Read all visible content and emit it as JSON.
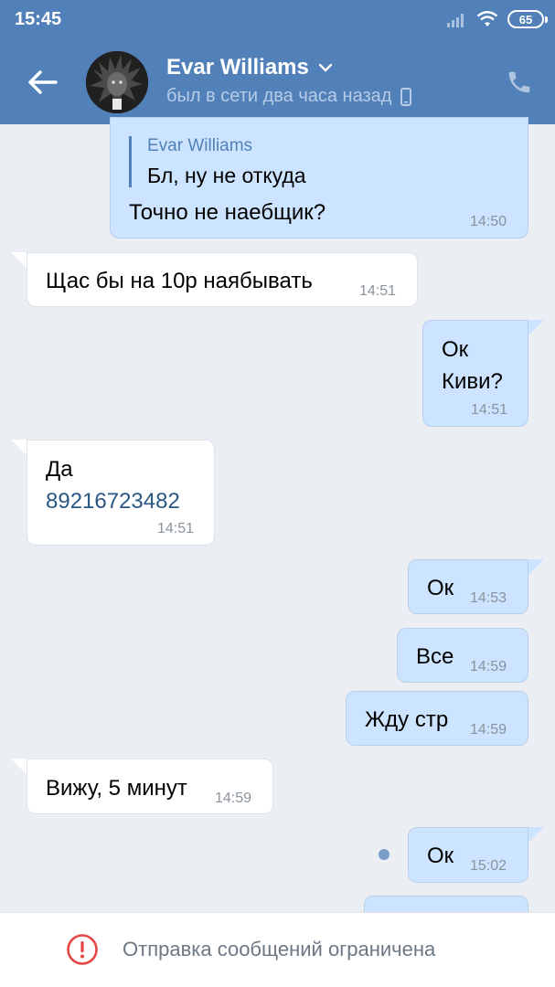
{
  "status_bar": {
    "time": "15:45",
    "battery": "65",
    "icons": [
      "signal-icon",
      "wifi-icon",
      "battery-icon"
    ]
  },
  "header": {
    "contact_name": "Evar Williams",
    "contact_status": "был в сети два часа назад",
    "icons": [
      "back-arrow-icon",
      "chevron-down-icon",
      "mobile-phone-icon",
      "phone-icon"
    ]
  },
  "messages": [
    {
      "direction": "out",
      "reply_to": {
        "author": "Evar Williams",
        "text": "Бл, ну не откуда"
      },
      "text": "Точно не наебщик?",
      "time": "14:50"
    },
    {
      "direction": "in",
      "text": "Щас бы на 10р наябывать",
      "time": "14:51"
    },
    {
      "direction": "out",
      "lines": [
        "Ок",
        "Киви?"
      ],
      "time": "14:51"
    },
    {
      "direction": "in",
      "text": "Да",
      "link": "89216723482",
      "time": "14:51"
    },
    {
      "direction": "out",
      "text": "Ок",
      "time": "14:53"
    },
    {
      "direction": "out",
      "text": "Все",
      "time": "14:59"
    },
    {
      "direction": "out",
      "text": "Жду стр",
      "time": "14:59"
    },
    {
      "direction": "in",
      "text": "Вижу, 5 минут",
      "time": "14:59"
    },
    {
      "direction": "out",
      "text": "Ок",
      "time": "15:02",
      "unread": true
    }
  ],
  "bottom_bar": {
    "notice": "Отправка сообщений ограничена",
    "icon": "alert-circle-icon"
  },
  "colors": {
    "header_bg": "#5181b8",
    "chat_bg": "#ebeff4",
    "outgoing_bubble": "#cce4ff",
    "incoming_bubble": "#ffffff",
    "alert": "#e64646"
  }
}
